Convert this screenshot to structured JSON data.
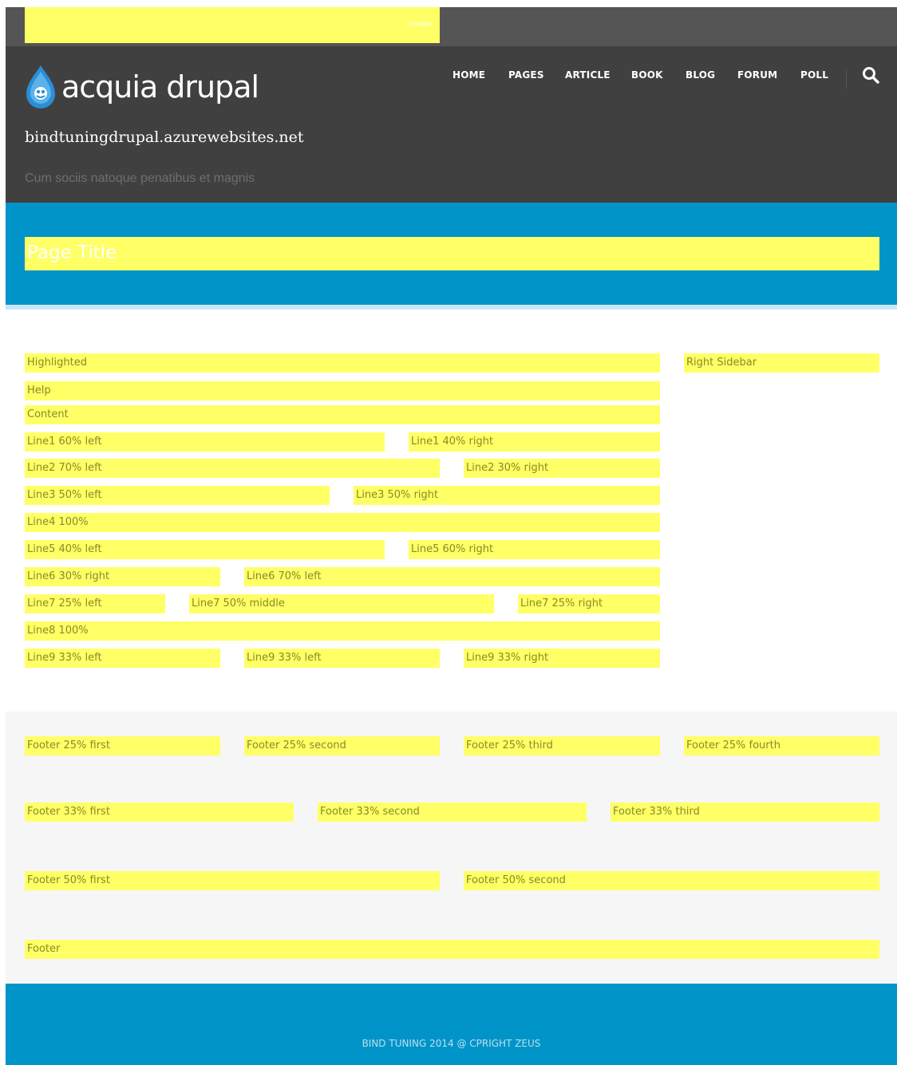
{
  "top_region": {
    "label": "Header"
  },
  "header": {
    "logo_text": "acquia drupal",
    "site_name": "bindtuningdrupal.azurewebsites.net",
    "slogan": "Cum sociis natoque penatibus et magnis"
  },
  "nav": {
    "items": [
      {
        "label": "HOME"
      },
      {
        "label": "PAGES"
      },
      {
        "label": "ARTICLE"
      },
      {
        "label": "BOOK"
      },
      {
        "label": "BLOG"
      },
      {
        "label": "FORUM"
      },
      {
        "label": "POLL"
      }
    ],
    "search_icon": "search-icon"
  },
  "page_title": "Page Title",
  "content": {
    "highlighted": "Highlighted",
    "help": "Help",
    "content": "Content",
    "right_sidebar": "Right Sidebar",
    "line1_left": "Line1 60% left",
    "line1_right": "Line1 40% right",
    "line2_left": "Line2 70% left",
    "line2_right": "Line2 30% right",
    "line3_left": "Line3 50% left",
    "line3_right": "Line3 50% right",
    "line4": "Line4 100%",
    "line5_left": "Line5 40% left",
    "line5_right": "Line5 60% right",
    "line6_right": "Line6 30% right",
    "line6_left": "Line6 70% left",
    "line7_left": "Line7 25% left",
    "line7_middle": "Line7 50% middle",
    "line7_right": "Line7 25% right",
    "line8": "Line8 100%",
    "line9_left_a": "Line9 33% left",
    "line9_left_b": "Line9 33% left",
    "line9_right": "Line9 33% right"
  },
  "footer": {
    "f25_first": "Footer 25% first",
    "f25_second": "Footer 25% second",
    "f25_third": "Footer 25% third",
    "f25_fourth": "Footer 25% fourth",
    "f33_first": "Footer 33% first",
    "f33_second": "Footer 33% second",
    "f33_third": "Footer 33% third",
    "f50_first": "Footer 50% first",
    "f50_second": "Footer 50% second",
    "footer": "Footer"
  },
  "copyright": "BIND TUNING 2014 @ CPRIGHT ZEUS",
  "colors": {
    "region_yellow": "#ffff66",
    "header_dark": "#404040",
    "accent_blue": "#0094c8"
  }
}
